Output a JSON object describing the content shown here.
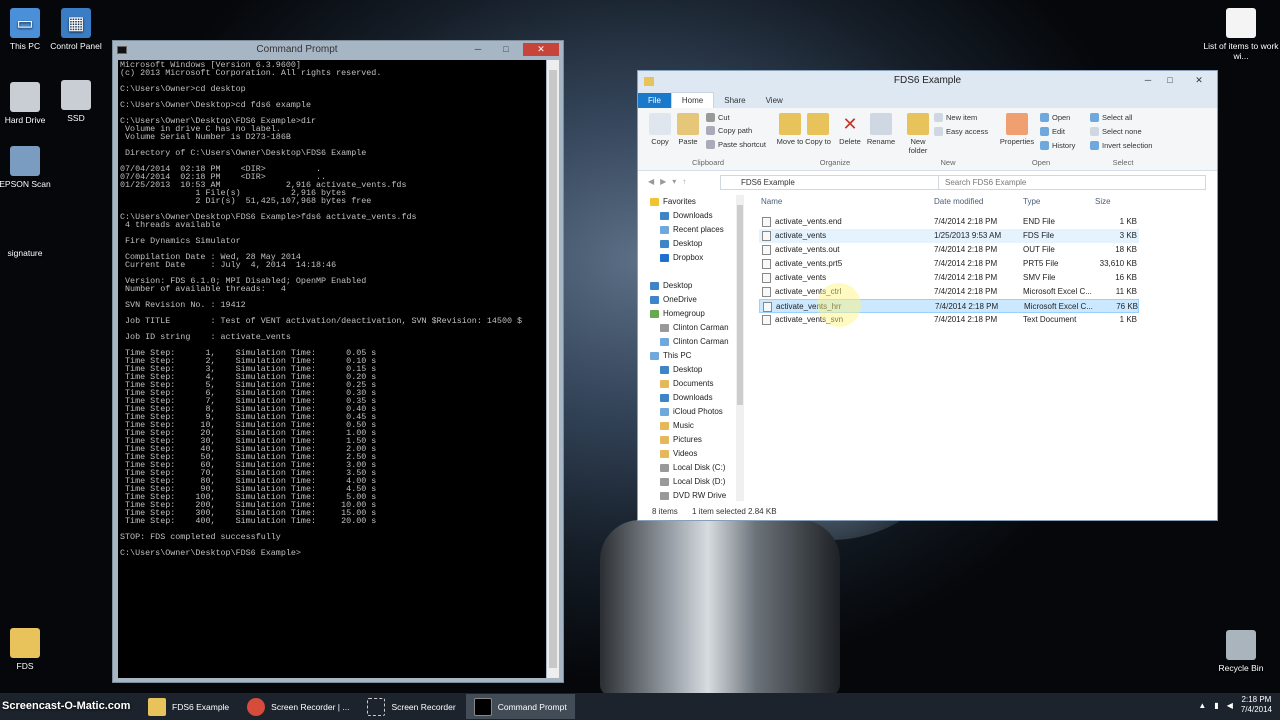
{
  "desktop_icons": [
    {
      "label": "This PC",
      "icon": "computer-icon"
    },
    {
      "label": "Control Panel",
      "icon": "control-panel-icon"
    },
    {
      "label": "Hard Drive",
      "icon": "drive-icon"
    },
    {
      "label": "SSD",
      "icon": "drive-icon"
    },
    {
      "label": "EPSON Scan",
      "icon": "scanner-icon"
    },
    {
      "label": "signature",
      "icon": ""
    },
    {
      "label": "FDS",
      "icon": "folder-icon"
    },
    {
      "label": "List of items to work wi...",
      "icon": "document-icon"
    },
    {
      "label": "Recycle Bin",
      "icon": "recycle-bin-icon"
    }
  ],
  "cmd": {
    "title": "Command Prompt",
    "lines": [
      "Microsoft Windows [Version 6.3.9600]",
      "(c) 2013 Microsoft Corporation. All rights reserved.",
      "",
      "C:\\Users\\Owner>cd desktop",
      "",
      "C:\\Users\\Owner\\Desktop>cd fds6 example",
      "",
      "C:\\Users\\Owner\\Desktop\\FDS6 Example>dir",
      " Volume in drive C has no label.",
      " Volume Serial Number is D273-186B",
      "",
      " Directory of C:\\Users\\Owner\\Desktop\\FDS6 Example",
      "",
      "07/04/2014  02:18 PM    <DIR>          .",
      "07/04/2014  02:18 PM    <DIR>          ..",
      "01/25/2013  10:53 AM             2,916 activate_vents.fds",
      "               1 File(s)          2,916 bytes",
      "               2 Dir(s)  51,425,107,968 bytes free",
      "",
      "C:\\Users\\Owner\\Desktop\\FDS6 Example>fds6 activate_vents.fds",
      " 4 threads available",
      "",
      " Fire Dynamics Simulator",
      "",
      " Compilation Date : Wed, 28 May 2014",
      " Current Date     : July  4, 2014  14:18:46",
      "",
      " Version: FDS 6.1.0; MPI Disabled; OpenMP Enabled",
      " Number of available threads:   4",
      "",
      " SVN Revision No. : 19412",
      "",
      " Job TITLE        : Test of VENT activation/deactivation, SVN $Revision: 14500 $",
      "",
      " Job ID string    : activate_vents",
      "",
      " Time Step:      1,    Simulation Time:      0.05 s",
      " Time Step:      2,    Simulation Time:      0.10 s",
      " Time Step:      3,    Simulation Time:      0.15 s",
      " Time Step:      4,    Simulation Time:      0.20 s",
      " Time Step:      5,    Simulation Time:      0.25 s",
      " Time Step:      6,    Simulation Time:      0.30 s",
      " Time Step:      7,    Simulation Time:      0.35 s",
      " Time Step:      8,    Simulation Time:      0.40 s",
      " Time Step:      9,    Simulation Time:      0.45 s",
      " Time Step:     10,    Simulation Time:      0.50 s",
      " Time Step:     20,    Simulation Time:      1.00 s",
      " Time Step:     30,    Simulation Time:      1.50 s",
      " Time Step:     40,    Simulation Time:      2.00 s",
      " Time Step:     50,    Simulation Time:      2.50 s",
      " Time Step:     60,    Simulation Time:      3.00 s",
      " Time Step:     70,    Simulation Time:      3.50 s",
      " Time Step:     80,    Simulation Time:      4.00 s",
      " Time Step:     90,    Simulation Time:      4.50 s",
      " Time Step:    100,    Simulation Time:      5.00 s",
      " Time Step:    200,    Simulation Time:     10.00 s",
      " Time Step:    300,    Simulation Time:     15.00 s",
      " Time Step:    400,    Simulation Time:     20.00 s",
      "",
      "STOP: FDS completed successfully",
      "",
      "C:\\Users\\Owner\\Desktop\\FDS6 Example>"
    ]
  },
  "explorer": {
    "title": "FDS6 Example",
    "tabs": [
      "File",
      "Home",
      "Share",
      "View"
    ],
    "ribbon": {
      "clipboard": {
        "copy": "Copy",
        "paste": "Paste",
        "cut": "Cut",
        "copy_path": "Copy path",
        "paste_shortcut": "Paste shortcut",
        "group": "Clipboard"
      },
      "organize": {
        "move_to": "Move to",
        "copy_to": "Copy to",
        "delete": "Delete",
        "rename": "Rename",
        "group": "Organize"
      },
      "new": {
        "new_folder": "New folder",
        "new_item": "New item",
        "easy_access": "Easy access",
        "group": "New"
      },
      "open": {
        "properties": "Properties",
        "open": "Open",
        "edit": "Edit",
        "history": "History",
        "group": "Open"
      },
      "select": {
        "select_all": "Select all",
        "select_none": "Select none",
        "invert": "Invert selection",
        "group": "Select"
      }
    },
    "path": "FDS6 Example",
    "search_placeholder": "Search FDS6 Example",
    "nav_pane": [
      {
        "label": "Favorites",
        "color": "#f1c232"
      },
      {
        "label": "Downloads",
        "color": "#3d85c6"
      },
      {
        "label": "Recent places",
        "color": "#6fa8dc"
      },
      {
        "label": "Desktop",
        "color": "#3d85c6"
      },
      {
        "label": "Dropbox",
        "color": "#1f6fd1"
      },
      {
        "label": "",
        "color": ""
      },
      {
        "label": "Desktop",
        "color": "#3d85c6"
      },
      {
        "label": "OneDrive",
        "color": "#3d85c6"
      },
      {
        "label": "Homegroup",
        "color": "#6aa84f"
      },
      {
        "label": "Clinton Carman",
        "color": "#999999"
      },
      {
        "label": "Clinton Carman",
        "color": "#6fa8dc"
      },
      {
        "label": "This PC",
        "color": "#6fa8dc"
      },
      {
        "label": "Desktop",
        "color": "#3d85c6"
      },
      {
        "label": "Documents",
        "color": "#e6b85c"
      },
      {
        "label": "Downloads",
        "color": "#3d85c6"
      },
      {
        "label": "iCloud Photos",
        "color": "#6fa8dc"
      },
      {
        "label": "Music",
        "color": "#e6b85c"
      },
      {
        "label": "Pictures",
        "color": "#e6b85c"
      },
      {
        "label": "Videos",
        "color": "#e6b85c"
      },
      {
        "label": "Local Disk (C:)",
        "color": "#999999"
      },
      {
        "label": "Local Disk (D:)",
        "color": "#999999"
      },
      {
        "label": "DVD RW Drive",
        "color": "#999999"
      }
    ],
    "columns": [
      "Name",
      "Date modified",
      "Type",
      "Size"
    ],
    "files": [
      {
        "name": "activate_vents.end",
        "date": "7/4/2014 2:18 PM",
        "type": "END File",
        "size": "1 KB"
      },
      {
        "name": "activate_vents",
        "date": "1/25/2013 9:53 AM",
        "type": "FDS File",
        "size": "3 KB"
      },
      {
        "name": "activate_vents.out",
        "date": "7/4/2014 2:18 PM",
        "type": "OUT File",
        "size": "18 KB"
      },
      {
        "name": "activate_vents.prt5",
        "date": "7/4/2014 2:18 PM",
        "type": "PRT5 File",
        "size": "33,610 KB"
      },
      {
        "name": "activate_vents",
        "date": "7/4/2014 2:18 PM",
        "type": "SMV File",
        "size": "16 KB"
      },
      {
        "name": "activate_vents_ctrl",
        "date": "7/4/2014 2:18 PM",
        "type": "Microsoft Excel C...",
        "size": "11 KB"
      },
      {
        "name": "activate_vents_hrr",
        "date": "7/4/2014 2:18 PM",
        "type": "Microsoft Excel C...",
        "size": "76 KB"
      },
      {
        "name": "activate_vents_svn",
        "date": "7/4/2014 2:18 PM",
        "type": "Text Document",
        "size": "1 KB"
      }
    ],
    "status": {
      "items": "8 items",
      "selected": "1 item selected  2.84 KB"
    }
  },
  "taskbar": {
    "watermark": "Screencast-O-Matic.com",
    "items": [
      "FDS6 Example",
      "Screen Recorder | ...",
      "Screen Recorder",
      "Command Prompt"
    ],
    "time": "2:18 PM",
    "date": "7/4/2014"
  }
}
